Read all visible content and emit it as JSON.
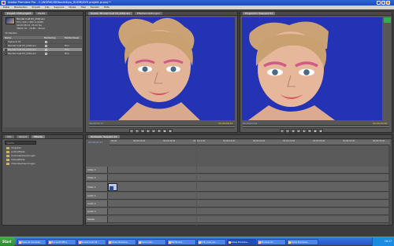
{
  "window": {
    "title": "Adobe Premiere Pro - C:\\WORK\\SRDtoolkit\\ep_DVDR\\DVR projekt.prproj *"
  },
  "menu": [
    "Datei",
    "Bearbeiten",
    "Projekt",
    "Clip",
    "Sequenz",
    "Marke",
    "Titel",
    "Fenster",
    "Hilfe"
  ],
  "project": {
    "tabs": [
      "Projekt: DVR-projekt",
      "Media"
    ],
    "clip_name": "Moodel Cust 03_(240).avi",
    "clip_info1": "Film, 640 x 480 (1,0000)",
    "clip_info2": "00:00:08:23, 25,00 fps",
    "clip_info3": "48000 Hz - 16-Bit - Stereo",
    "count": "30 Objekte",
    "columns": [
      "Name",
      "Medientyp",
      "Mediendauer"
    ],
    "rows": [
      {
        "name": "Sequenz 01",
        "type": "",
        "dur": ""
      },
      {
        "name": "Moodel Cust 03_(240).avi",
        "type": "",
        "dur": "Film"
      },
      {
        "name": "Moodel Cust 03_(240).avi",
        "type": "",
        "dur": "Film"
      },
      {
        "name": "Moodel Cust 03_(240).avi",
        "type": "",
        "dur": "Film"
      }
    ]
  },
  "source_monitor": {
    "tabs": [
      "Quelle: Moodel Cust 03_(240).avi",
      "Effekteinstellungen"
    ],
    "tc_in": "00;00;07;17",
    "tc_out": "00;00;08;23"
  },
  "program_monitor": {
    "tabs": [
      "Programm: Sequenz 01"
    ],
    "tc_in": "00;00;07;16",
    "tc_out": "00;00;00;00"
  },
  "effects": {
    "tabs": [
      "Info",
      "Verlauf",
      "Effekte"
    ],
    "search": "Suche",
    "folders": [
      "Vorgaben",
      "Audioeffekte",
      "Audioüberblendungen",
      "Videoeffekte",
      "Videoüberblendungen"
    ]
  },
  "timeline": {
    "tabs": [
      "Zeitleiste: Sequenz 01"
    ],
    "timecode": "00;00;07;17",
    "ticks": [
      "00;00",
      "00;00;04;00",
      "00;00;08;00",
      "00;00;12;00",
      "00;00;16;00",
      "00;00;20;00",
      "00;00;24;00",
      "00;00;28;00",
      "00;00;32;00",
      "00;00;36;00"
    ],
    "tracks": [
      "Video 3",
      "Video 2",
      "Video 1",
      "Audio 1",
      "Audio 2",
      "Audio 3",
      "Master"
    ],
    "clip_label": "Moodel Cust 03"
  },
  "taskbar": {
    "start": "Start",
    "tasks": [
      "Diese ist Anmelde...",
      "Microsoft Office",
      "Moodel Cust 03...",
      "Adobe Premiere...",
      "Camcorder...",
      "SRDToolkit...",
      "DVD_Cust_ver...",
      "Adobe Premiere...",
      "Windows M...",
      "Adobe Premiere..."
    ],
    "clock": "16:17"
  },
  "colors": {
    "video_bg": "#2230b8",
    "playhead": "#d02020",
    "titlebar": "#2356c7"
  }
}
